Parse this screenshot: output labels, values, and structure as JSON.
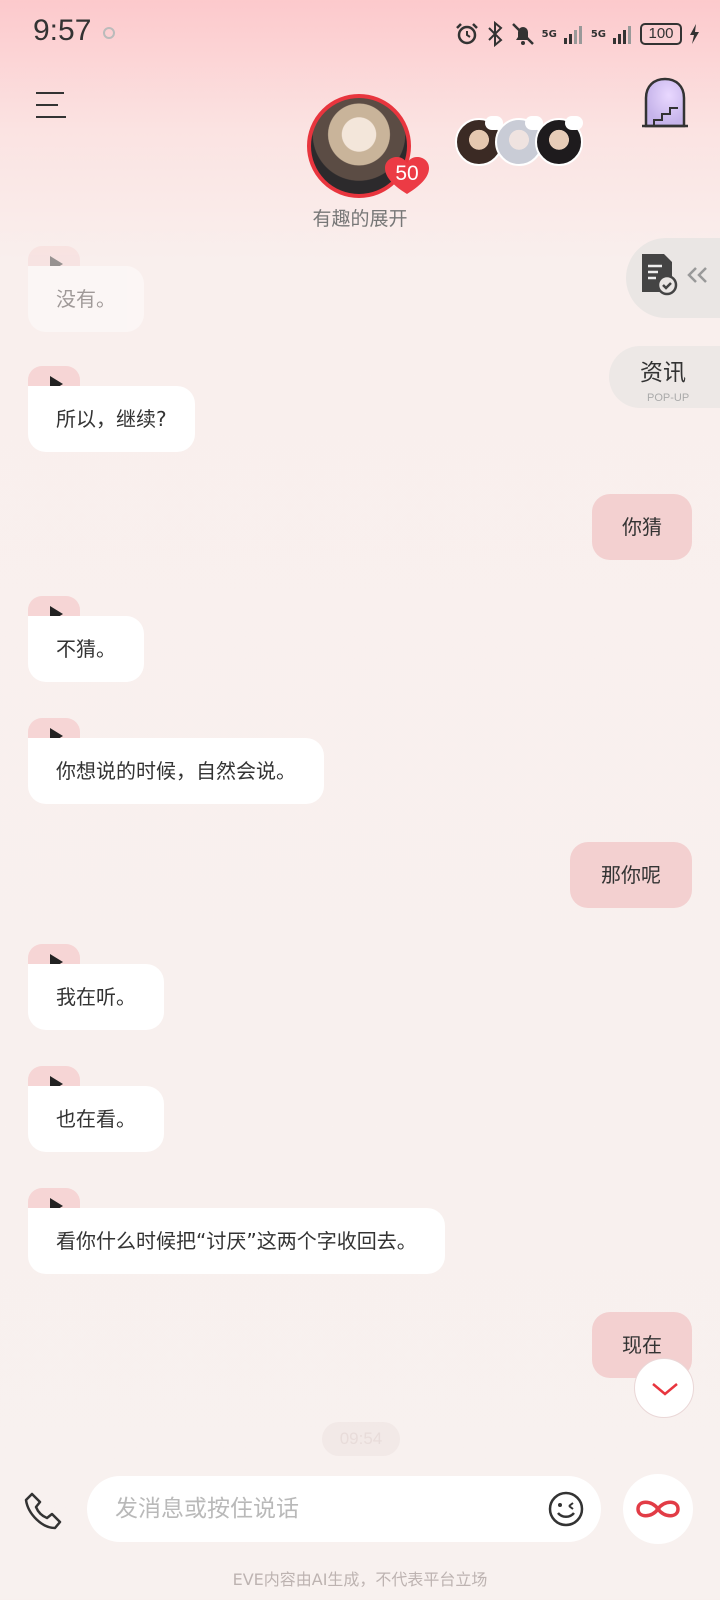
{
  "status_bar": {
    "time": "9:57",
    "network_1": "5G",
    "network_2": "5G",
    "battery": "100"
  },
  "header": {
    "character_level": "50",
    "character_title": "有趣的展开"
  },
  "side_tabs": {
    "news_label": "资讯",
    "news_sub": "POP-UP"
  },
  "messages": [
    {
      "sender": "character",
      "text": "没有。"
    },
    {
      "sender": "character",
      "text": "所以，继续?"
    },
    {
      "sender": "user",
      "text": "你猜"
    },
    {
      "sender": "character",
      "text": "不猜。"
    },
    {
      "sender": "character",
      "text": "你想说的时候，自然会说。"
    },
    {
      "sender": "user",
      "text": "那你呢"
    },
    {
      "sender": "character",
      "text": "我在听。"
    },
    {
      "sender": "character",
      "text": "也在看。"
    },
    {
      "sender": "character",
      "text": "看你什么时候把“讨厌”这两个字收回去。"
    },
    {
      "sender": "user",
      "text": "现在"
    }
  ],
  "timestamp": "09:54",
  "input": {
    "placeholder": "发消息或按住说话"
  },
  "footer": {
    "disclaimer": "EVE内容由AI生成，不代表平台立场"
  },
  "colors": {
    "accent": "#e8353e",
    "user_bubble": "#f3d0d0",
    "play_tab": "#f6d5d5"
  },
  "icons": [
    "menu-icon",
    "play-icon",
    "document-check-icon",
    "phone-icon",
    "emoji-icon",
    "infinity-icon",
    "chevron-down-icon",
    "room-door-icon"
  ]
}
